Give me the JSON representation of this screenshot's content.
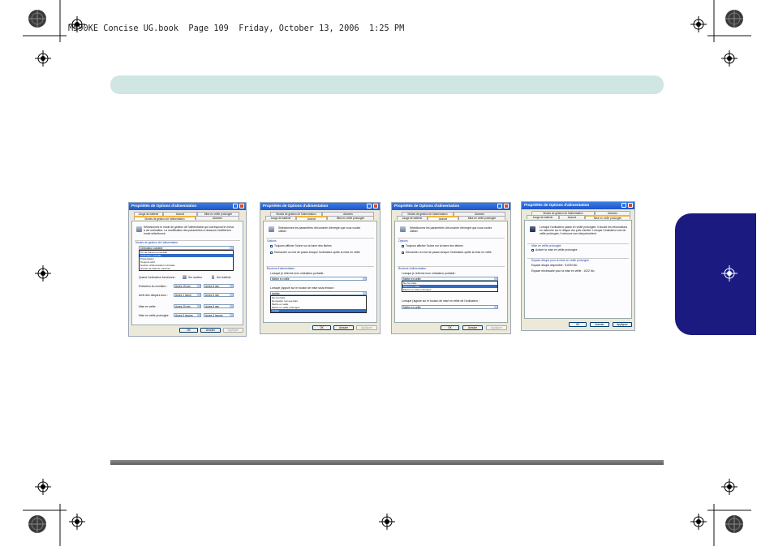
{
  "page": {
    "header_text": "M590KE Concise UG.book  Page 109  Friday, October 13, 2006  1:25 PM",
    "accent_color": "#cfe6e2",
    "side_tab_color": "#1a1a80"
  },
  "screenshots": [
    {
      "title": "Propriétés de Options d'alimentation",
      "tabs": [
        "Jauge de batterie",
        "Avancé",
        "Mise en veille prolongée",
        "Modes de gestion de l'alimentation",
        "Alarmes"
      ],
      "description": "Sélectionnez le mode de gestion de l'alimentation qui correspond le mieux à cet ordinateur. La modification des paramètres ci-dessous modifiera le mode sélectionné.",
      "group_label": "Modes de gestion de l'alimentation",
      "dropdown_value": "Ordinateur portable",
      "list_items": [
        "PC de bureau ou familial",
        "Ordinateur portable",
        "Présentation",
        "Toujours actif",
        "Gestion d'alimentation minimale",
        "Niveau de batterie maximal"
      ],
      "selected_index": 1,
      "label_when": "Quand l'ordinateur fonctionne :",
      "col_ac": "Sur secteur",
      "col_batt": "Sur batterie",
      "rows": [
        {
          "label": "Extinction du moniteur :",
          "ac": "Après 15 min",
          "batt": "Après 5 min"
        },
        {
          "label": "Arrêt des disques durs :",
          "ac": "Après 1 heure",
          "batt": "Après 5 min"
        },
        {
          "label": "Mise en veille :",
          "ac": "Après 20 min",
          "batt": "Après 5 min"
        },
        {
          "label": "Mise en veille prolongée :",
          "ac": "Après 3 heures",
          "batt": "Après 3 heures"
        }
      ],
      "buttons": [
        "OK",
        "Annuler",
        "Appliquer"
      ]
    },
    {
      "title": "Propriétés de Options d'alimentation",
      "tabs": [
        "Modes de gestion de l'alimentation",
        "Alarmes",
        "Jauge de batterie",
        "Avancé",
        "Mise en veille prolongée"
      ],
      "description": "Sélectionnez les paramètres d'économie d'énergie que vous voulez utiliser.",
      "options_label": "Options",
      "checks": [
        "Toujours afficher l'icône sur la barre des tâches",
        "Demander un mot de passe lorsque l'ordinateur quitte la mise en veille"
      ],
      "buttons_label": "Boutons d'alimentation",
      "q1": "Lorsque je referme mon ordinateur portable :",
      "v1": "Mettre en veille",
      "q2": "Lorsque j'appuie sur le bouton de mise sous tension :",
      "v2": "Arrêter",
      "list_items": [
        "Ne rien faire",
        "Demander moi que faire",
        "Mettre en veille",
        "Mettre en veille prolongée",
        "Arrêter"
      ],
      "selected_index": 4,
      "buttons": [
        "OK",
        "Annuler",
        "Appliquer"
      ]
    },
    {
      "title": "Propriétés de Options d'alimentation",
      "tabs": [
        "Modes de gestion de l'alimentation",
        "Alarmes",
        "Jauge de batterie",
        "Avancé",
        "Mise en veille prolongée"
      ],
      "description": "Sélectionnez les paramètres d'économie d'énergie que vous voulez utiliser.",
      "options_label": "Options",
      "checks": [
        "Toujours afficher l'icône sur la barre des tâches",
        "Demander un mot de passe lorsque l'ordinateur quitte la mise en veille"
      ],
      "buttons_label": "Boutons d'alimentation",
      "q1": "Lorsque je referme mon ordinateur portable :",
      "v1": "Mettre en veille",
      "list_items": [
        "Ne rien faire",
        "Mettre en veille",
        "Mettre en veille prolongée"
      ],
      "selected_index": 1,
      "q2": "Lorsque j'appuie sur le bouton de mise en veille de l'ordinateur :",
      "v2": "Mettre en veille",
      "buttons": [
        "OK",
        "Annuler",
        "Appliquer"
      ]
    },
    {
      "title": "Propriétés de Options d'alimentation",
      "tabs": [
        "Modes de gestion de l'alimentation",
        "Alarmes",
        "Jauge de batterie",
        "Avancé",
        "Mise en veille prolongée"
      ],
      "description": "Lorsque l'ordinateur passe en veille prolongée, il stocke les informations en mémoire sur le disque dur puis s'arrête. Lorsque l'ordinateur sort de veille prolongée, il retrouve son état précédent.",
      "group1_label": "Mise en veille prolongée",
      "check": "Activer la mise en veille prolongée",
      "group2_label": "Espace disque pour la mise en veille prolongée",
      "free_space": "Espace disque disponible : 51094 Mo",
      "needed_space": "Espace nécessaire pour la mise en veille : 1022 Mo",
      "buttons": [
        "OK",
        "Annuler",
        "Appliquer"
      ]
    }
  ]
}
